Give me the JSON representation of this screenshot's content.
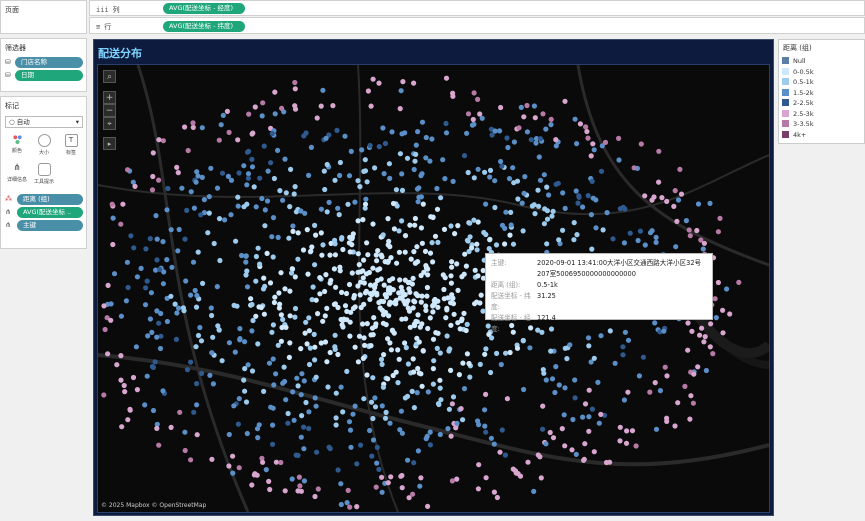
{
  "pages_pane": {
    "title": "页面"
  },
  "shelves": {
    "columns": {
      "label": "列",
      "icon": "iii",
      "pill": "AVG(配送坐标 - 经度)"
    },
    "rows": {
      "label": "行",
      "icon": "≡",
      "pill": "AVG(配送坐标 - 纬度)"
    }
  },
  "filters": {
    "title": "筛选器",
    "items": [
      "门店名称",
      "日期"
    ]
  },
  "marks": {
    "title": "标记",
    "type": "自动",
    "buttons": [
      {
        "label": "颜色",
        "icon": "color-icon"
      },
      {
        "label": "大小",
        "icon": "size-icon"
      },
      {
        "label": "标签",
        "icon": "label-icon"
      },
      {
        "label": "详细信息",
        "icon": "detail-icon"
      },
      {
        "label": "工具提示",
        "icon": "tooltip-icon"
      }
    ],
    "pills": [
      "距离 (组)",
      "AVG(配送坐标 ..",
      "主键"
    ]
  },
  "dashboard": {
    "title": "配送分布"
  },
  "map": {
    "attribution": "© 2025 Mapbox © OpenStreetMap",
    "controls": [
      "⌕",
      "+",
      "−",
      "⌖",
      "▸"
    ]
  },
  "tooltip": {
    "rows": [
      {
        "key": "主键:",
        "value": "2020-09-01 13:41:00大洋小区交通西路大洋小区32号207室5006950000000000000"
      },
      {
        "key": "距离 (组):",
        "value": "0.5-1k"
      },
      {
        "key": "配送坐标 - 纬度:",
        "value": "31.25"
      },
      {
        "key": "配送坐标 - 经度:",
        "value": "121.4"
      }
    ]
  },
  "legend": {
    "title": "距离 (组)",
    "items": [
      {
        "label": "Null",
        "color": "#5a7fa3"
      },
      {
        "label": "0-0.5k",
        "color": "#cfe8fb"
      },
      {
        "label": "0.5-1k",
        "color": "#9ccbee"
      },
      {
        "label": "1.5-2k",
        "color": "#5a8fc8"
      },
      {
        "label": "2-2.5k",
        "color": "#2f5a8f"
      },
      {
        "label": "2.5-3k",
        "color": "#d9a6cf"
      },
      {
        "label": "3-3.5k",
        "color": "#b77aa6"
      },
      {
        "label": "4k+",
        "color": "#7a3c6a"
      }
    ]
  }
}
